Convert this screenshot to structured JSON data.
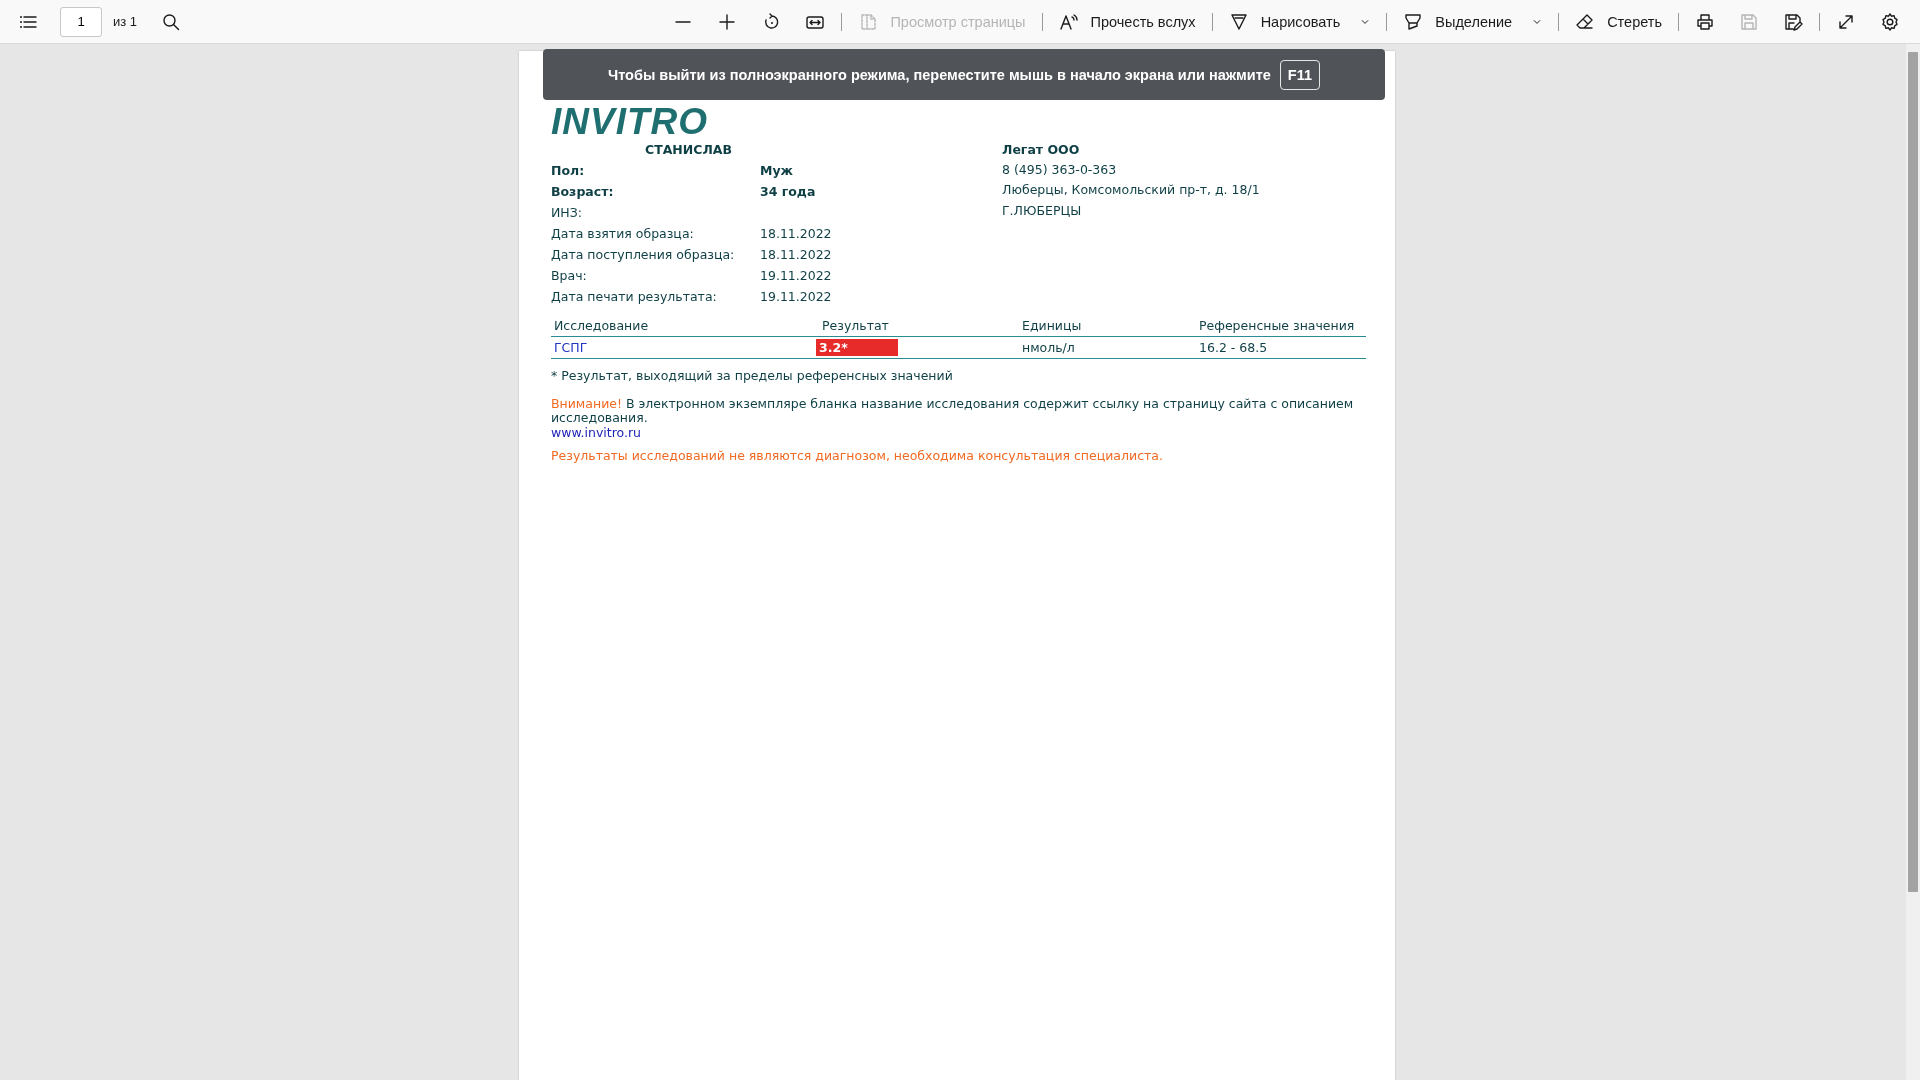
{
  "toolbar": {
    "page_number": "1",
    "page_total": "из 1",
    "tools": [
      {
        "kind": "page-view",
        "label": "Просмотр страницы",
        "disabled": true,
        "dropdown": false
      },
      {
        "kind": "read-aloud",
        "label": "Прочесть вслух",
        "disabled": false,
        "dropdown": false
      },
      {
        "kind": "draw",
        "label": "Нарисовать",
        "disabled": false,
        "dropdown": true
      },
      {
        "kind": "highlight",
        "label": "Выделение",
        "disabled": false,
        "dropdown": true
      },
      {
        "kind": "erase",
        "label": "Стереть",
        "disabled": false,
        "dropdown": false
      }
    ],
    "file_buttons": [
      {
        "kind": "print",
        "disabled": false
      },
      {
        "kind": "save",
        "disabled": true
      },
      {
        "kind": "save-as",
        "disabled": false
      }
    ]
  },
  "banner": {
    "message": "Чтобы выйти из полноэкранного режима, переместите мышь в начало экрана или нажмите",
    "key": "F11"
  },
  "document": {
    "logo": "INVITRO",
    "patient_name": "СТАНИСЛАВ",
    "patient_rows": [
      {
        "label": "Пол:",
        "value": "Муж",
        "bold": true
      },
      {
        "label": "Возраст:",
        "value": "34 года",
        "bold": true
      },
      {
        "label": "ИНЗ:",
        "bold": false
      },
      {
        "label": "Дата взятия образца:",
        "value": "18.11.2022",
        "bold": false
      },
      {
        "label": "Дата поступления образца:",
        "value": "18.11.2022",
        "bold": false
      },
      {
        "label": "Врач:",
        "value": "19.11.2022",
        "bold": false
      },
      {
        "label": "Дата печати результата:",
        "value": "19.11.2022",
        "bold": false
      }
    ],
    "lab": {
      "name": "Легат ООО",
      "lines": [
        "8 (495) 363-0-363",
        "Люберцы, Комсомольский пр-т, д. 18/1",
        "Г.ЛЮБЕРЦЫ"
      ]
    },
    "table": {
      "columns": [
        "Исследование",
        "Результат",
        "Единицы",
        "Референсные значения"
      ],
      "rows": [
        {
          "test": "ГСПГ",
          "result": "3.2*",
          "out_of_range": true,
          "units": "нмоль/л",
          "reference": "16.2 - 68.5"
        }
      ]
    },
    "footnote": "* Результат, выходящий за пределы референсных значений",
    "notice": {
      "lead": "Внимание!",
      "text": "В электронном экземпляре бланка название исследования содержит ссылку на страницу сайта с описанием исследования.",
      "link": "www.invitro.ru"
    },
    "disclaimer": "Результаты исследований не являются диагнозом, необходима консультация специалиста."
  }
}
